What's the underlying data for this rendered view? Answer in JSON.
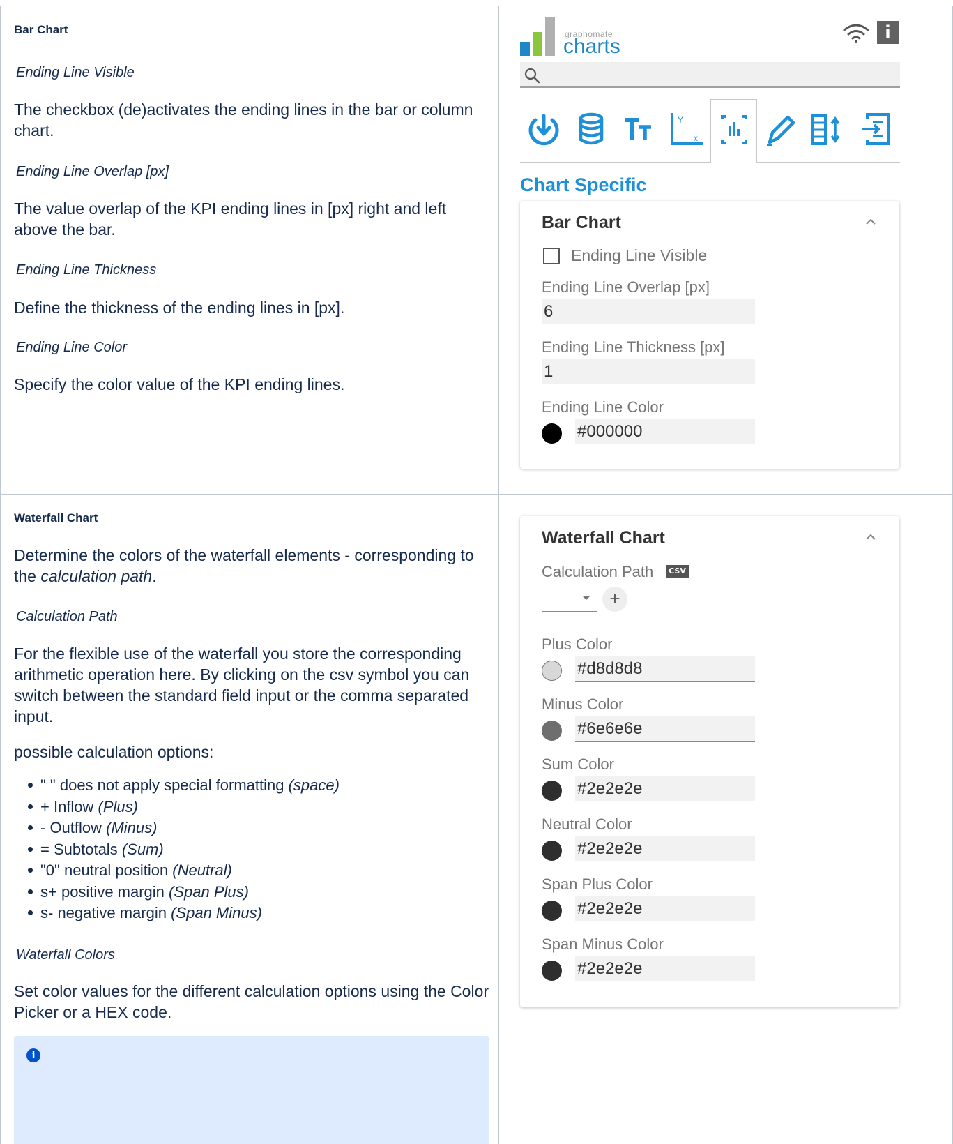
{
  "doc": {
    "bar_section": {
      "heading": "Bar Chart",
      "items": [
        {
          "title": "Ending Line Visible",
          "text": "The checkbox (de)activates the ending lines in the bar or column chart."
        },
        {
          "title": "Ending Line Overlap [px]",
          "text": "The value overlap of the KPI ending lines in [px] right and left above the bar."
        },
        {
          "title": "Ending Line Thickness",
          "text": "Define the thickness of the ending lines in [px]."
        },
        {
          "title": "Ending Line Color",
          "text": "Specify the color value of the KPI ending lines."
        }
      ]
    },
    "waterfall_section": {
      "heading": "Waterfall Chart",
      "intro_before": "Determine the colors of the waterfall elements - corresponding to the ",
      "intro_em": "calculation path",
      "intro_after": ".",
      "calc_title": "Calculation Path",
      "calc_text": "For the flexible use of the waterfall you store the corresponding arithmetic operation here. By clicking on the csv symbol you can switch between the standard field input or the comma separated input.",
      "options_lead": "possible calculation options:",
      "options": [
        {
          "text": "\" \" does not apply special formatting ",
          "em": "(space)"
        },
        {
          "text": "+ Inflow ",
          "em": "(Plus)"
        },
        {
          "text": "- Outflow ",
          "em": "(Minus)"
        },
        {
          "text": "= Subtotals ",
          "em": "(Sum)"
        },
        {
          "text": "\"0\" neutral position ",
          "em": "(Neutral)"
        },
        {
          "text": "s+ positive margin ",
          "em": "(Span Plus)"
        },
        {
          "text": "s- negative margin ",
          "em": "(Span Minus)"
        }
      ],
      "colors_title": "Waterfall Colors",
      "colors_text": "Set color values for the different calculation options using the Color Picker or a HEX code."
    }
  },
  "app": {
    "logo_top": "graphomate",
    "logo_main": "charts",
    "logo_colors": [
      "#1e88c7",
      "#8cc63f",
      "#b0b0b0"
    ],
    "accent": "#1e90d8",
    "search_placeholder": "",
    "tabs": [
      "data-refresh-icon",
      "database-icon",
      "text-format-icon",
      "axis-icon",
      "chart-specific-icon",
      "pen-icon",
      "table-sort-icon",
      "export-icon"
    ],
    "active_tab": "chart-specific-icon",
    "section_title": "Chart Specific"
  },
  "bar_card": {
    "title": "Bar Chart",
    "visible_label": "Ending Line Visible",
    "visible_checked": false,
    "overlap_label": "Ending Line Overlap [px]",
    "overlap_value": "6",
    "thickness_label": "Ending Line Thickness [px]",
    "thickness_value": "1",
    "color_label": "Ending Line Color",
    "color_value": "#000000"
  },
  "waterfall_card": {
    "title": "Waterfall Chart",
    "calc_label": "Calculation Path",
    "csv_label": "CSV",
    "add_label": "+",
    "colors": [
      {
        "label": "Plus Color",
        "value": "#d8d8d8",
        "swatch": "#d8d8d8"
      },
      {
        "label": "Minus Color",
        "value": "#6e6e6e",
        "swatch": "#6e6e6e"
      },
      {
        "label": "Sum Color",
        "value": "#2e2e2e",
        "swatch": "#2e2e2e"
      },
      {
        "label": "Neutral Color",
        "value": "#2e2e2e",
        "swatch": "#2e2e2e"
      },
      {
        "label": "Span Plus Color",
        "value": "#2e2e2e",
        "swatch": "#2e2e2e"
      },
      {
        "label": "Span Minus Color",
        "value": "#2e2e2e",
        "swatch": "#2e2e2e"
      }
    ]
  }
}
